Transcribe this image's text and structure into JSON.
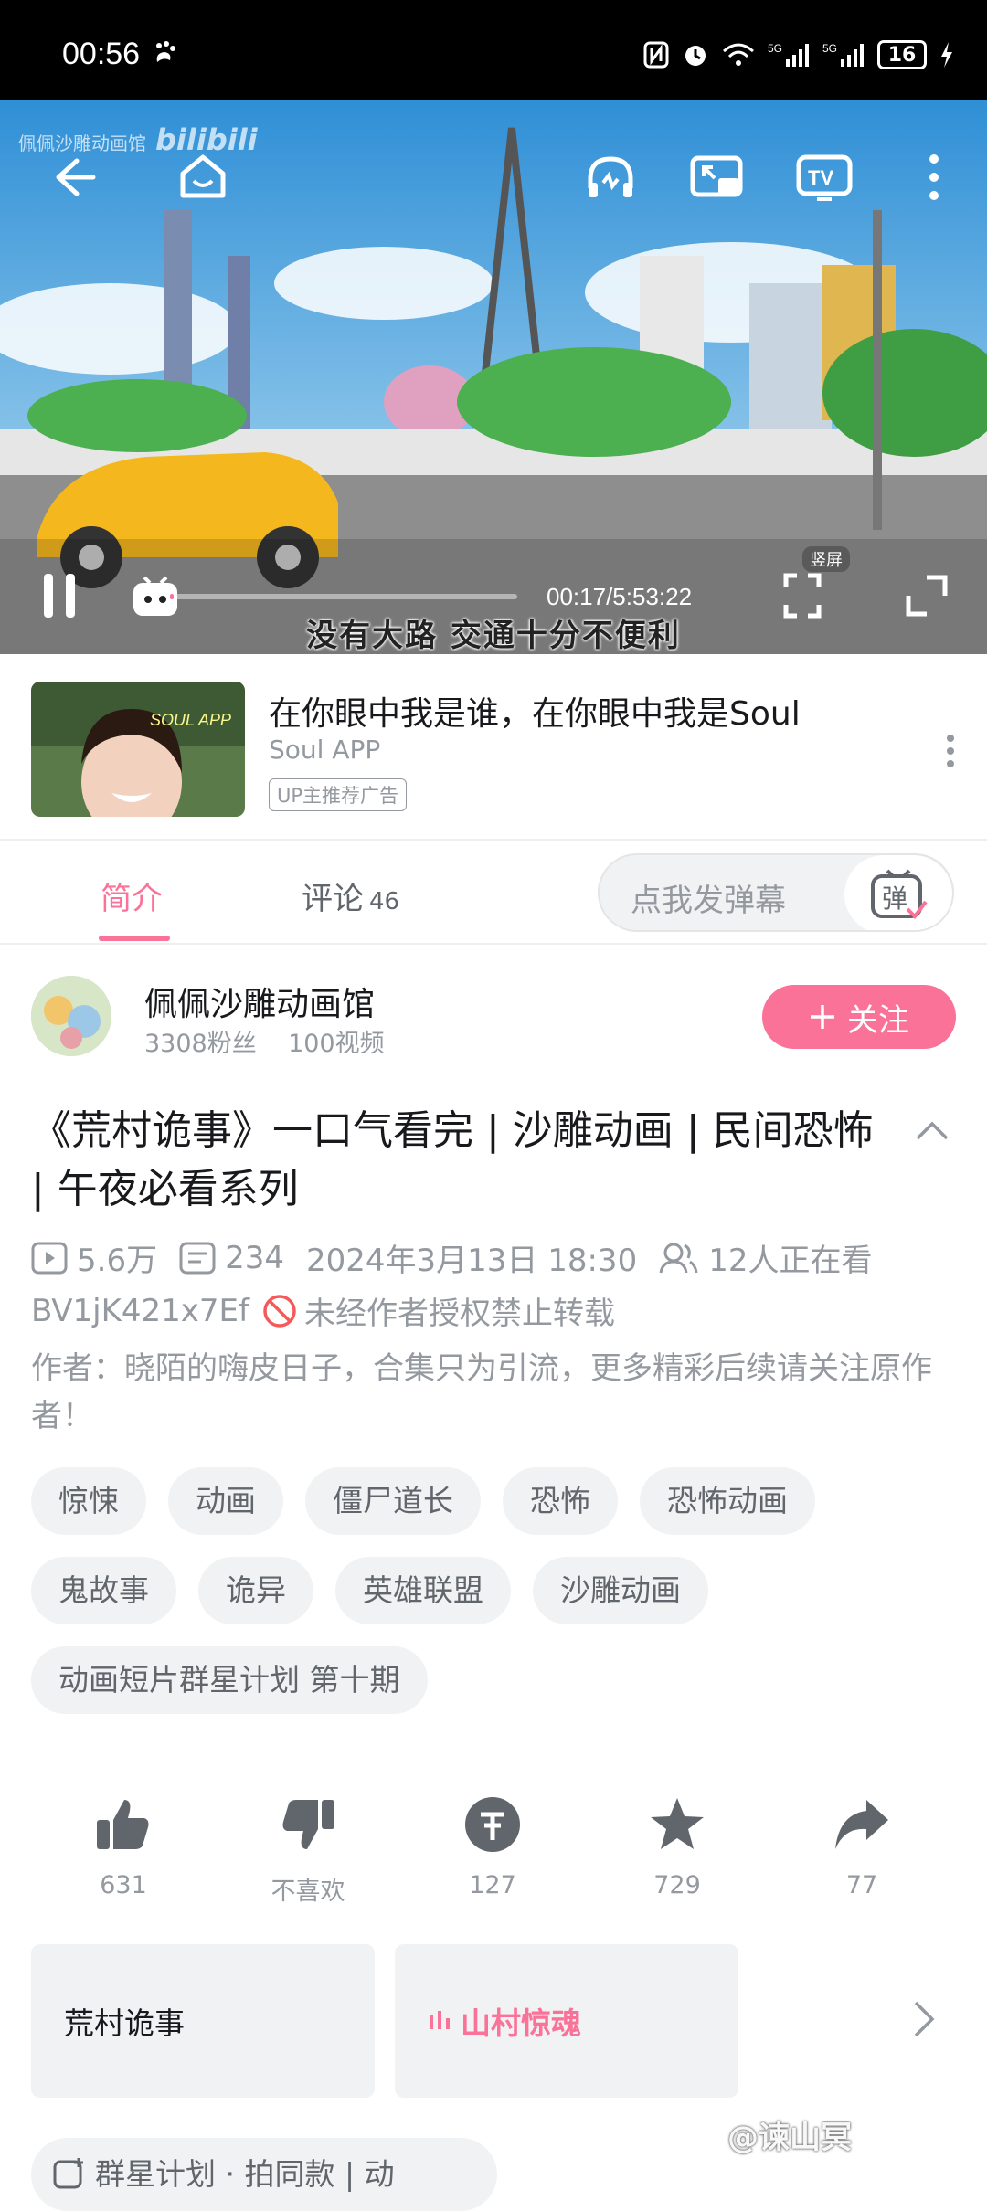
{
  "status_bar": {
    "time": "00:56",
    "battery": "16",
    "icons": [
      "nfc-icon",
      "alarm-icon",
      "wifi-icon",
      "signal-5g-icon",
      "signal-5g-icon",
      "battery-icon",
      "charging-icon"
    ]
  },
  "player": {
    "watermark": "佩佩沙雕动画馆",
    "watermark_brand": "bilibili",
    "time_readout": "00:17/5:53:22",
    "vertical_label": "竖屏",
    "subtitle": "没有大路 交通十分不便利",
    "progress": 0.0008
  },
  "ad": {
    "title": "在你眼中我是谁，在你眼中我是Soul",
    "advertiser": "Soul APP",
    "badge": "UP主推荐广告",
    "thumb_text": "SOUL APP"
  },
  "tabs": {
    "intro": "简介",
    "comments": "评论",
    "comments_count": "46",
    "danmu_placeholder": "点我发弹幕",
    "danmu_button": "弹"
  },
  "uploader": {
    "name": "佩佩沙雕动画馆",
    "fans": "3308粉丝",
    "videos": "100视频",
    "follow_label": "关注"
  },
  "video": {
    "title": "《荒村诡事》一口气看完 | 沙雕动画 | 民间恐怖 | 午夜必看系列",
    "views": "5.6万",
    "danmaku": "234",
    "date": "2024年3月13日 18:30",
    "watching": "12人正在看",
    "bvid": "BV1jK421x7Ef",
    "copyright": "未经作者授权禁止转载",
    "description": "作者：晓陌的嗨皮日子，合集只为引流，更多精彩后续请关注原作者！"
  },
  "tags": [
    "惊悚",
    "动画",
    "僵尸道长",
    "恐怖",
    "恐怖动画",
    "鬼故事",
    "诡异",
    "英雄联盟",
    "沙雕动画",
    "动画短片群星计划 第十期"
  ],
  "actions": {
    "like": "631",
    "dislike": "不喜欢",
    "coin": "127",
    "favorite": "729",
    "share": "77"
  },
  "series": {
    "item1": "荒村诡事",
    "item2": "山村惊魂"
  },
  "bottom": {
    "pill": "群星计划 · 拍同款 | 动",
    "watermark": "@谏山冥"
  },
  "colors": {
    "accent": "#fb7299",
    "muted": "#9499a0",
    "tag_bg": "#f1f2f3"
  }
}
